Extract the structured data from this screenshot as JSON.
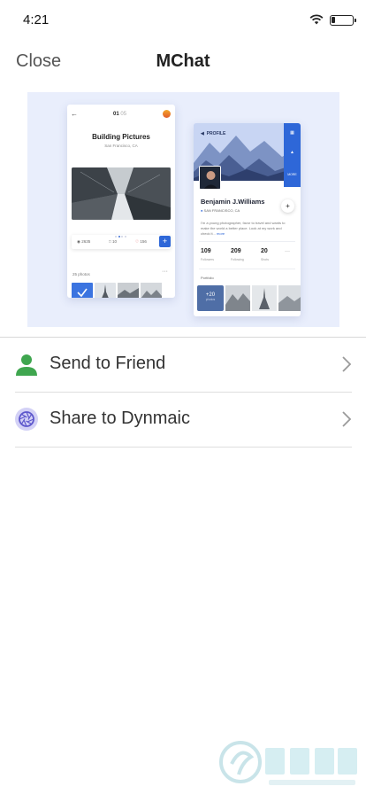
{
  "status_bar": {
    "time": "4:21"
  },
  "nav": {
    "close_label": "Close",
    "title": "MChat"
  },
  "preview": {
    "card1": {
      "page_current": "01",
      "page_total": "05",
      "title": "Building Pictures",
      "subtitle": "San Francisco, CA",
      "stats": {
        "views": "2635",
        "comments": "10",
        "likes": "156"
      },
      "photos_count": "25 photos"
    },
    "card2": {
      "header_label": "PROFILE",
      "side_button": "MORE",
      "name": "Benjamin J.Williams",
      "location": "SAN FRANCISCO, CA",
      "bio": "I'm a young photographer, favor to travel and wants to make the world a better place. Look at my work and check it...",
      "bio_more": "more",
      "stats": [
        {
          "value": "109",
          "label": "Followers"
        },
        {
          "value": "209",
          "label": "Following"
        },
        {
          "value": "20",
          "label": "Shots"
        }
      ],
      "portfolio_label": "Portfolio",
      "more_photos": "+20",
      "more_photos_sub": "photos"
    }
  },
  "actions": [
    {
      "label": "Send to Friend",
      "icon": "person-icon",
      "color": "#3fa64f"
    },
    {
      "label": "Share to Dynmaic",
      "icon": "aperture-icon",
      "color": "#6b66d6"
    }
  ]
}
